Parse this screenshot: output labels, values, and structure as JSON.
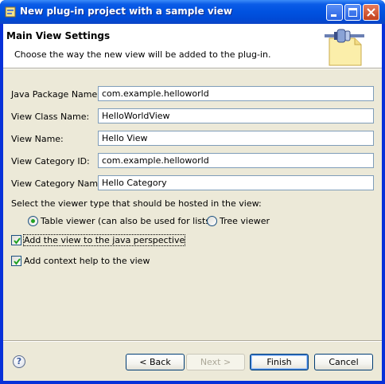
{
  "window": {
    "title": "New plug-in project with a sample view"
  },
  "banner": {
    "title": "Main View Settings",
    "description": "Choose the way the new view will be added to the plug-in."
  },
  "form": {
    "package_label": "Java Package Name:",
    "package_value": "com.example.helloworld",
    "class_label": "View Class Name:",
    "class_value": "HelloWorldView",
    "name_label": "View Name:",
    "name_value": "Hello View",
    "category_id_label": "View Category ID:",
    "category_id_value": "com.example.helloworld",
    "category_name_label": "View Category Name:",
    "category_name_value": "Hello Category"
  },
  "viewer": {
    "prompt": "Select the viewer type that should be hosted in the view:",
    "table_label": "Table viewer (can also be used for lists)",
    "table_selected": true,
    "tree_label": "Tree viewer",
    "tree_selected": false
  },
  "options": {
    "perspective_label": "Add the view to the java perspective",
    "perspective_checked": true,
    "context_help_label": "Add context help to the view",
    "context_help_checked": true
  },
  "buttons": {
    "help": "?",
    "back": "< Back",
    "next": "Next >",
    "finish": "Finish",
    "cancel": "Cancel"
  },
  "icons": {
    "app": "eclipse-plugin-icon",
    "banner": "plugin-wizard-icon",
    "help": "help-icon"
  },
  "colors": {
    "titlebar": "#0054e3",
    "dialog_bg": "#ece9d8",
    "input_border": "#7f9db9",
    "radio_dot": "#21a121"
  }
}
